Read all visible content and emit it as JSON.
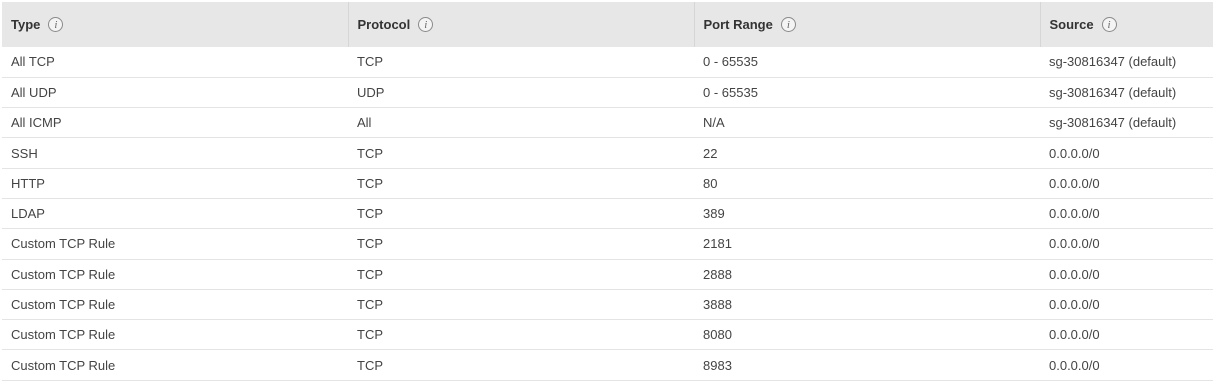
{
  "headers": [
    {
      "label": "Type",
      "icon": "info-icon"
    },
    {
      "label": "Protocol",
      "icon": "info-icon"
    },
    {
      "label": "Port Range",
      "icon": "info-icon"
    },
    {
      "label": "Source",
      "icon": "info-icon"
    }
  ],
  "info_glyph": "i",
  "rows": [
    {
      "type": "All TCP",
      "protocol": "TCP",
      "port_range": "0 - 65535",
      "source": "sg-30816347 (default)"
    },
    {
      "type": "All UDP",
      "protocol": "UDP",
      "port_range": "0 - 65535",
      "source": "sg-30816347 (default)"
    },
    {
      "type": "All ICMP",
      "protocol": "All",
      "port_range": "N/A",
      "source": "sg-30816347 (default)"
    },
    {
      "type": "SSH",
      "protocol": "TCP",
      "port_range": "22",
      "source": "0.0.0.0/0"
    },
    {
      "type": "HTTP",
      "protocol": "TCP",
      "port_range": "80",
      "source": "0.0.0.0/0"
    },
    {
      "type": "LDAP",
      "protocol": "TCP",
      "port_range": "389",
      "source": "0.0.0.0/0"
    },
    {
      "type": "Custom TCP Rule",
      "protocol": "TCP",
      "port_range": "2181",
      "source": "0.0.0.0/0"
    },
    {
      "type": "Custom TCP Rule",
      "protocol": "TCP",
      "port_range": "2888",
      "source": "0.0.0.0/0"
    },
    {
      "type": "Custom TCP Rule",
      "protocol": "TCP",
      "port_range": "3888",
      "source": "0.0.0.0/0"
    },
    {
      "type": "Custom TCP Rule",
      "protocol": "TCP",
      "port_range": "8080",
      "source": "0.0.0.0/0"
    },
    {
      "type": "Custom TCP Rule",
      "protocol": "TCP",
      "port_range": "8983",
      "source": "0.0.0.0/0"
    }
  ]
}
